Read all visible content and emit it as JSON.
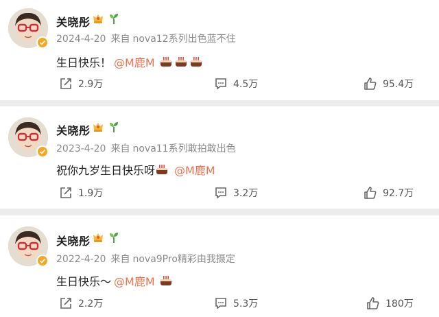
{
  "posts": [
    {
      "username": "关晓彤",
      "date": "2024-4-20",
      "source_prefix": "来自",
      "source": "nova12系列出色蓝不住",
      "text": "生日快乐！",
      "mention": "@M鹿M",
      "cake_count": 3,
      "reposts": "2.9万",
      "comments": "4.5万",
      "likes": "95.4万"
    },
    {
      "username": "关晓彤",
      "date": "2023-4-20",
      "source_prefix": "来自",
      "source": "nova11系列敢拍敢出色",
      "text": "祝你九岁生日快乐呀",
      "mention": "@M鹿M",
      "cake_count": 1,
      "reposts": "1.9万",
      "comments": "3.2万",
      "likes": "92.7万"
    },
    {
      "username": "关晓彤",
      "date": "2022-4-20",
      "source_prefix": "来自",
      "source": "nova9Pro精彩由我摄定",
      "text": "生日快乐～",
      "mention": "@M鹿M",
      "cake_count": 1,
      "reposts": "2.2万",
      "comments": "5.3万",
      "likes": "180万"
    }
  ],
  "icons": {
    "verified_badge": "verified-badge-icon",
    "crown": "crown-icon",
    "sprout": "sprout-icon",
    "cake": "cake-icon",
    "repost": "repost-icon",
    "comment": "comment-icon",
    "like": "like-icon"
  },
  "colors": {
    "mention": "#eb7350",
    "meta": "#8a8a8a",
    "badge": "#f5a623",
    "background": "#ececec",
    "card": "#ffffff"
  }
}
